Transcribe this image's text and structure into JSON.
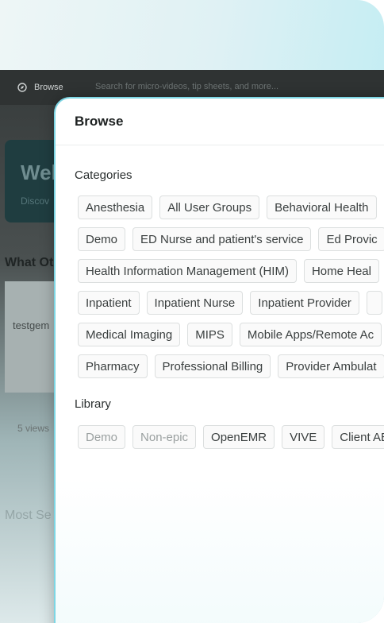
{
  "app_bar": {
    "browse_label": "Browse",
    "search_placeholder": "Search for micro-videos, tip sheets, and more..."
  },
  "background_page": {
    "hero_title": "Wel",
    "hero_subtitle": "Discov",
    "section_title": "What Ot",
    "card_meta": "testgem",
    "card_views": "5 views",
    "section_title2": "Most Se"
  },
  "modal": {
    "title": "Browse",
    "categories_label": "Categories",
    "category_rows": [
      [
        "Anesthesia",
        "All User Groups",
        "Behavioral Health"
      ],
      [
        "Demo",
        "ED Nurse and patient's service",
        "Ed Provic"
      ],
      [
        "Health Information Management (HIM)",
        "Home Heal"
      ],
      [
        "Inpatient",
        "Inpatient Nurse",
        "Inpatient Provider"
      ],
      [
        "Medical Imaging",
        "MIPS",
        "Mobile Apps/Remote Ac"
      ],
      [
        "Pharmacy",
        "Professional Billing",
        "Provider Ambulat"
      ]
    ],
    "library_label": "Library",
    "library_items": [
      "Demo",
      "Non-epic",
      "OpenEMR",
      "VIVE",
      "Client AE"
    ]
  },
  "colors": {
    "accent_border": "#7dd6e4",
    "app_bar": "#2f3333",
    "chip_border": "#dcdfdf"
  }
}
